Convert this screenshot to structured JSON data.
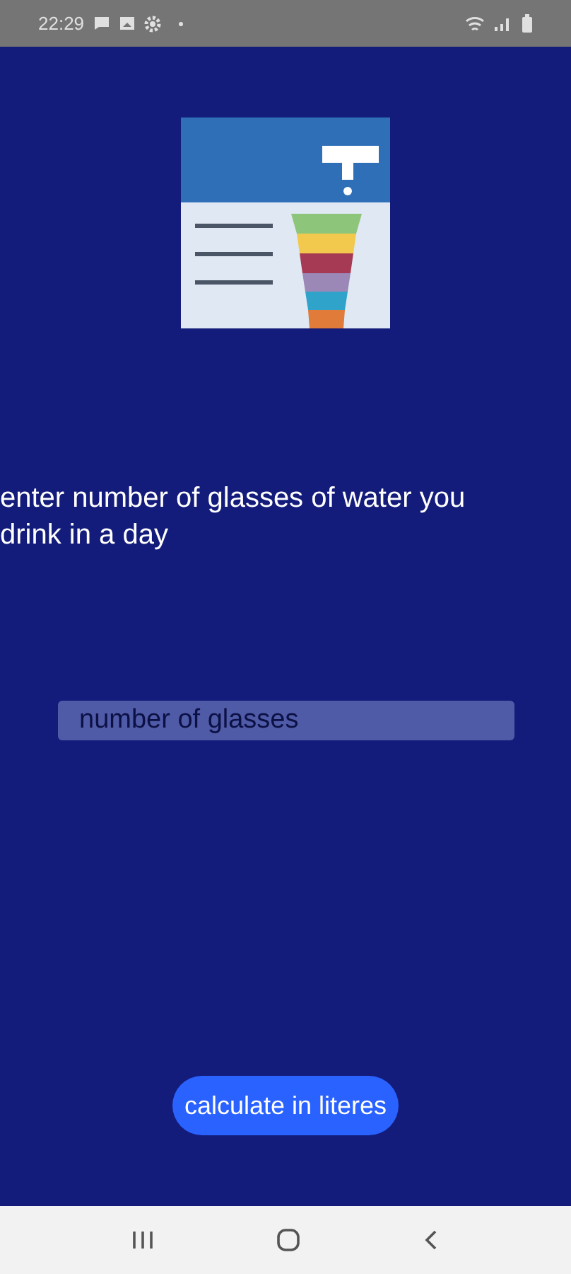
{
  "status_bar": {
    "time": "22:29"
  },
  "prompt": "enter number of glasses of water you drink in a day",
  "glasses_field": {
    "placeholder": "number of glasses"
  },
  "calculate_button": "calculate in literes"
}
